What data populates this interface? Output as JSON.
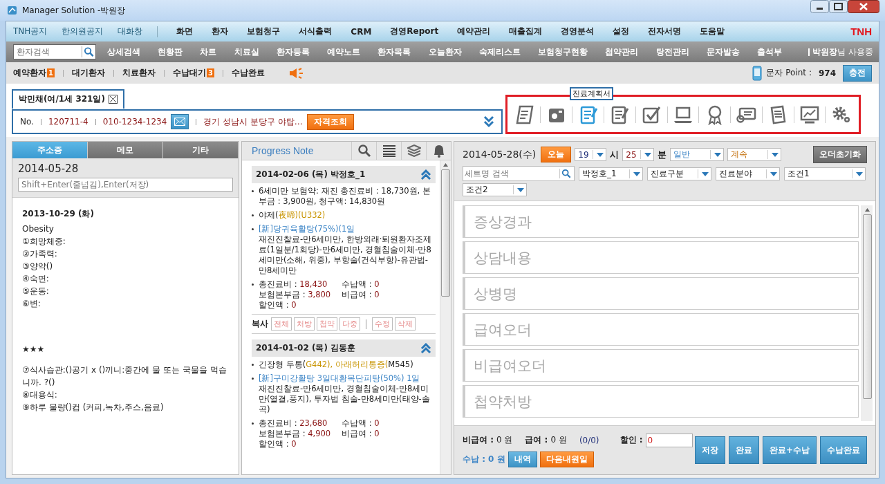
{
  "window": {
    "title": "Manager Solution -박원장"
  },
  "menu_bar": {
    "notice_links": [
      "TNH공지",
      "한의원공지",
      "대화창"
    ],
    "items": [
      "화면",
      "환자",
      "보험청구",
      "서식출력",
      "CRM",
      "경영Report",
      "예약관리",
      "매출집계",
      "경영분석",
      "설정",
      "전자서명",
      "도움말"
    ],
    "brand": "TNH"
  },
  "toolbar": {
    "search": {
      "placeholder": "환자검색"
    },
    "items": [
      "상세검색",
      "현황판",
      "차트",
      "치료실",
      "환자등록",
      "예약노트",
      "환자목록",
      "오늘환자",
      "숙제리스트",
      "보험청구현황",
      "첩약관리",
      "탕전관리",
      "문자발송",
      "출석부"
    ],
    "user_name": "박원장",
    "user_suffix": "님 사용중"
  },
  "status_tabs": [
    {
      "label": "예약환자",
      "count": "1"
    },
    {
      "label": "대기환자"
    },
    {
      "label": "치료환자"
    },
    {
      "label": "수납대기",
      "count": "3"
    },
    {
      "label": "수납완료"
    }
  ],
  "sms": {
    "label": "문자 Point :",
    "points": "974",
    "button": "충전"
  },
  "patient": {
    "tab": "박민채(여/1세 321일)",
    "no_label": "No.",
    "chart_no": "120711-4",
    "phone": "010-1234-1234",
    "address": "경기 성남시 분당구 야탑…",
    "check_button": "자격조회"
  },
  "tool_icons": {
    "tooltip": "진료계획서",
    "items": [
      {
        "kind": "scroll",
        "selected": false
      },
      {
        "kind": "camera",
        "selected": false
      },
      {
        "kind": "checklist",
        "selected": true
      },
      {
        "kind": "edit",
        "selected": false
      },
      {
        "kind": "check",
        "selected": false
      },
      {
        "kind": "laptop",
        "selected": false
      },
      {
        "kind": "ribbon",
        "selected": false
      },
      {
        "kind": "card",
        "selected": false
      },
      {
        "kind": "pages",
        "selected": false
      },
      {
        "kind": "chart",
        "selected": false
      },
      {
        "kind": "gear",
        "selected": false
      }
    ]
  },
  "complaint_panel": {
    "tabs": [
      {
        "label": "주소증",
        "selected": true
      },
      {
        "label": "메모",
        "selected": false
      },
      {
        "label": "기타",
        "selected": false
      }
    ],
    "date": "2014-05-28",
    "input": {
      "placeholder": "Shift+Enter(줄넘김),Enter(저장)"
    },
    "memo": {
      "date": "2013-10-29 (화)",
      "lines": [
        {
          "kind": "line",
          "text": "Obesity"
        },
        {
          "kind": "line",
          "text": "①희망체중:"
        },
        {
          "kind": "line",
          "text": "②가족력:"
        },
        {
          "kind": "line",
          "text": "③양약()"
        },
        {
          "kind": "line",
          "text": "④숙면:"
        },
        {
          "kind": "line",
          "text": "⑤운동:"
        },
        {
          "kind": "line",
          "text": "⑥변:"
        },
        {
          "kind": "emphasis",
          "text": "★★★"
        },
        {
          "kind": "line",
          "text": "⑦식사습관:()공기 x ()끼니:중간에 물 또는 국물을 먹습니까. ?()"
        },
        {
          "kind": "line",
          "text": "⑧대용식:"
        },
        {
          "kind": "line",
          "text": "⑨하루 물량()컵 (커피,녹차,주스,음료)"
        }
      ]
    }
  },
  "progress_note": {
    "title": "Progress Note",
    "notes": [
      {
        "header": "2014-02-06 (목) 박정호_1",
        "expanded": true,
        "items": [
          {
            "kind": "text",
            "segments": [
              {
                "kind": "plain",
                "text": "6세미만 보험약: 재진 총진료비 : 18,730원, 본부금 : 3,900원, 청구액: 14,830원"
              }
            ]
          },
          {
            "kind": "text",
            "segments": [
              {
                "kind": "plain",
                "text": "야제("
              },
              {
                "kind": "code",
                "text": "夜啼)(U332)"
              }
            ]
          },
          {
            "kind": "prescription",
            "title": "[新]당귀육활탕(75%)(1일",
            "detail": "재진진찰료-만6세미만, 한방외래·퇴원환자조제료(1일분/1회당)-만6세미만, 경혈침술이체-만8세미만(소해, 위중), 부항술(건식부항)-유관법-만8세미만"
          },
          {
            "kind": "amounts",
            "values": [
              {
                "label": "총진료비 :",
                "value": "18,430"
              },
              {
                "label": "수납액 :",
                "value": "0"
              },
              {
                "label": "보험본부금 :",
                "value": "3,800"
              },
              {
                "label": "비급여 :",
                "value": "0"
              },
              {
                "label": "할인액 :",
                "value": "0"
              }
            ]
          }
        ],
        "actions": {
          "label": "복사",
          "copy": [
            "전체",
            "처방",
            "첩약",
            "다중"
          ],
          "edit": [
            "수정",
            "삭제"
          ]
        }
      },
      {
        "header": "2014-01-02 (목) 김동훈",
        "expanded": true,
        "items": [
          {
            "kind": "text",
            "segments": [
              {
                "kind": "plain",
                "text": "긴장형 두통("
              },
              {
                "kind": "code",
                "text": "G442), 아래허리통증("
              },
              {
                "kind": "plain",
                "text": "M545)"
              }
            ]
          },
          {
            "kind": "prescription",
            "title": "[新]구미강활탕 3일대황목단피탕(50%) 1일",
            "detail": "재진진찰료-만6세미만, 경혈침술이체-만8세미만(열결,풍지), 투자법 침술-만8세미만(태양-솔곡)"
          },
          {
            "kind": "amounts",
            "values": [
              {
                "label": "총진료비 :",
                "value": "23,680"
              },
              {
                "label": "수납액 :",
                "value": "0"
              },
              {
                "label": "보험본부금 :",
                "value": "4,900"
              },
              {
                "label": "비급여 :",
                "value": "0"
              },
              {
                "label": "할인액 :",
                "value": "0"
              }
            ]
          }
        ]
      }
    ]
  },
  "order_panel": {
    "date": "2014-05-28(수)",
    "today_button": "오늘",
    "hour": "19",
    "hour_unit": "시",
    "minute": "25",
    "minute_unit": "분",
    "visit_type": "일반",
    "continuity": "계속",
    "reset_button": "오더초기화",
    "set_search": {
      "placeholder": "세트명 검색"
    },
    "dropdowns": [
      "박정호_1",
      "진료구분",
      "진료분야",
      "조건1",
      "조건2"
    ],
    "fields": [
      {
        "placeholder": "증상경과"
      },
      {
        "placeholder": "상담내용"
      },
      {
        "placeholder": "상병명"
      },
      {
        "placeholder": "급여오더"
      },
      {
        "placeholder": "비급여오더"
      },
      {
        "placeholder": "첩약처방"
      }
    ],
    "totals": {
      "non_covered_label": "비급여 :",
      "non_covered": "0 원",
      "covered_label": "급여 :",
      "covered": "0 원",
      "covered_ratio": "(0/0)",
      "discount_label": "할인 :",
      "discount": "0",
      "paid_label": "수납 :",
      "paid": "0 원"
    },
    "history_button": "내역",
    "next_visit_button": "다음내원일",
    "actions": [
      "저장",
      "완료",
      "완료+수납",
      "수납완료"
    ]
  }
}
